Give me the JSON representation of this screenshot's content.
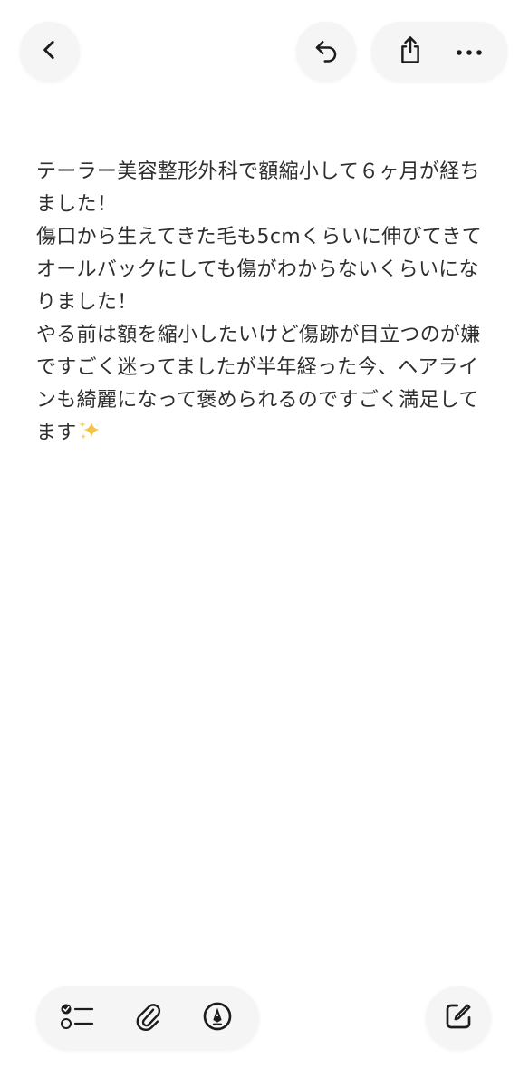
{
  "toolbar": {
    "back_icon": "chevron-left-icon",
    "undo_icon": "undo-icon",
    "share_icon": "share-icon",
    "more_icon": "more-icon"
  },
  "note": {
    "lines": [
      "テーラー美容整形外科で額縮小して６ヶ月が経ちました！",
      "傷口から生えてきた毛も5cmくらいに伸びてきてオールバックにしても傷がわからないくらいになりました！",
      "やる前は額を縮小したいけど傷跡が目立つのが嫌ですごく迷ってましたが半年経った今、ヘアラインも綺麗になって褒められるのですごく満足してます"
    ],
    "trailing_emoji": "sparkles-icon"
  },
  "bottom_bar": {
    "checklist_icon": "checklist-icon",
    "attachment_icon": "paperclip-icon",
    "markup_icon": "markup-pen-icon",
    "compose_icon": "compose-icon"
  },
  "colors": {
    "icon": "#1c1c1e",
    "text": "#2e2e2e",
    "pill_bg": "#f5f5f5",
    "sparkle": "#f5c542"
  }
}
